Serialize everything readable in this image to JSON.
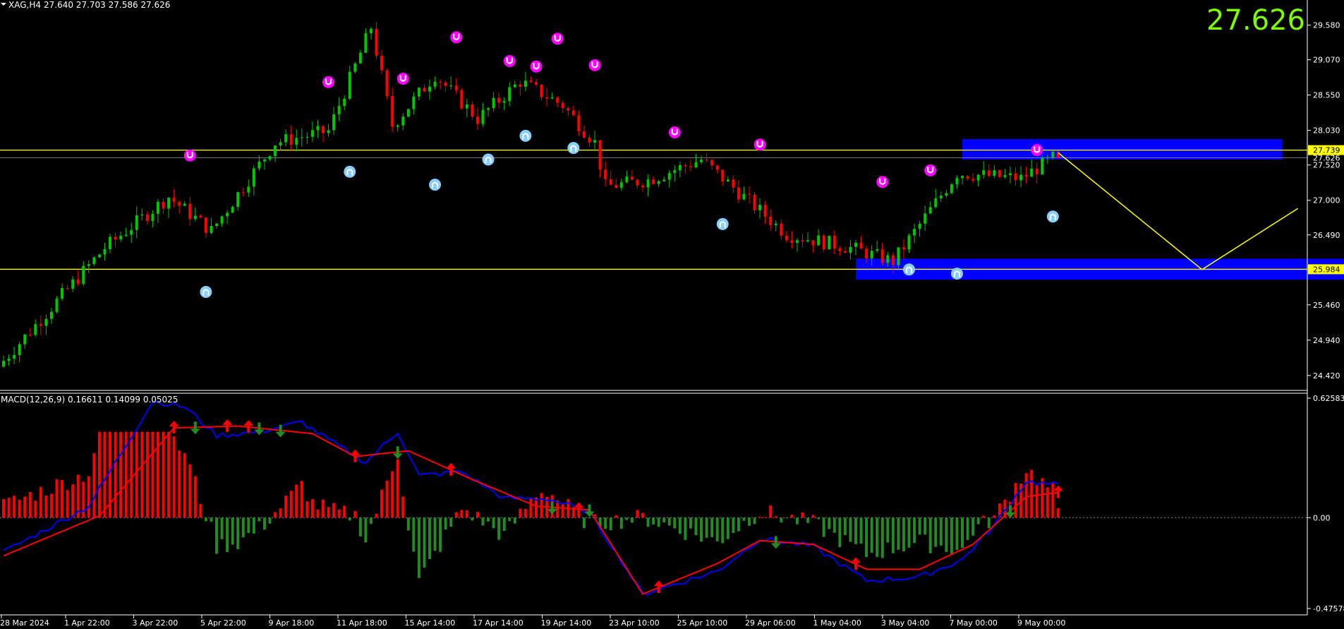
{
  "header": {
    "symbol": "XAG,H4",
    "ohlc": "27.640 27.703 27.586 27.626",
    "big_price": "27.626"
  },
  "macd": {
    "label": "MACD(12,26,9) 0.16611 0.14099 0.05025"
  },
  "colors": {
    "background": "#000000",
    "bull": "#00c800",
    "bear": "#ff0000",
    "level_line": "#ffff00",
    "zone": "#0000ff",
    "fractal_up": "#ff00ff",
    "fractal_down": "#87cefa",
    "macd_line": "#0000ff",
    "signal_line": "#ff0000",
    "big_price": "#7cfc00",
    "axis_text": "#ffffff"
  },
  "chart_data": [
    {
      "type": "candlestick",
      "symbol": "XAG",
      "timeframe": "H4",
      "price_axis": [
        "29.580",
        "29.070",
        "28.550",
        "28.030",
        "27.520",
        "27.000",
        "26.490",
        "25.460",
        "24.940",
        "24.420"
      ],
      "price_labels": [
        {
          "text": "27.739",
          "value": 27.739,
          "style": "yellow"
        },
        {
          "text": "27.626",
          "value": 27.626,
          "style": "plain"
        },
        {
          "text": "25.984",
          "value": 25.984,
          "style": "yellow"
        }
      ],
      "ylim": [
        24.2,
        29.95
      ],
      "time_axis": [
        "28 Mar 2024",
        "1 Apr 22:00",
        "3 Apr 22:00",
        "5 Apr 22:00",
        "9 Apr 18:00",
        "11 Apr 18:00",
        "15 Apr 14:00",
        "17 Apr 14:00",
        "19 Apr 14:00",
        "23 Apr 10:00",
        "25 Apr 10:00",
        "29 Apr 06:00",
        "1 May 04:00",
        "3 May 04:00",
        "7 May 00:00",
        "9 May 00:00"
      ],
      "candle_count": 241,
      "key_points": [
        {
          "bar": 0,
          "price": 24.55
        },
        {
          "bar": 20,
          "price": 26.3
        },
        {
          "bar": 32,
          "price": 27.05
        },
        {
          "bar": 40,
          "price": 26.55
        },
        {
          "bar": 52,
          "price": 27.85
        },
        {
          "bar": 62,
          "price": 28.02
        },
        {
          "bar": 70,
          "price": 29.55
        },
        {
          "bar": 74,
          "price": 28.1
        },
        {
          "bar": 82,
          "price": 28.85
        },
        {
          "bar": 90,
          "price": 28.2
        },
        {
          "bar": 98,
          "price": 28.75
        },
        {
          "bar": 106,
          "price": 28.4
        },
        {
          "bar": 112,
          "price": 27.85
        },
        {
          "bar": 114,
          "price": 27.2
        },
        {
          "bar": 122,
          "price": 27.3
        },
        {
          "bar": 132,
          "price": 27.6
        },
        {
          "bar": 148,
          "price": 26.5
        },
        {
          "bar": 160,
          "price": 26.3
        },
        {
          "bar": 168,
          "price": 26.1
        },
        {
          "bar": 180,
          "price": 27.4
        },
        {
          "bar": 192,
          "price": 27.32
        },
        {
          "bar": 198,
          "price": 27.62
        }
      ],
      "levels": [
        27.739,
        25.984
      ],
      "zones": [
        {
          "from_bar": 180,
          "to_bar": 240,
          "low": 27.6,
          "high": 27.9
        },
        {
          "from_bar": 160,
          "to_bar": 253,
          "low": 25.83,
          "high": 26.14
        }
      ],
      "projection": [
        {
          "bar": 198,
          "price": 27.7
        },
        {
          "bar": 225,
          "price": 25.98
        },
        {
          "bar": 243,
          "price": 26.88
        }
      ],
      "fractals_up": [
        {
          "bar": 35,
          "price": 27.66
        },
        {
          "bar": 61,
          "price": 28.74
        },
        {
          "bar": 75,
          "price": 28.79
        },
        {
          "bar": 85,
          "price": 29.4
        },
        {
          "bar": 95,
          "price": 29.05
        },
        {
          "bar": 100,
          "price": 28.97
        },
        {
          "bar": 104,
          "price": 29.38
        },
        {
          "bar": 111,
          "price": 28.99
        },
        {
          "bar": 126,
          "price": 28.0
        },
        {
          "bar": 142,
          "price": 27.82
        },
        {
          "bar": 165,
          "price": 27.27
        },
        {
          "bar": 174,
          "price": 27.44
        },
        {
          "bar": 194,
          "price": 27.74
        }
      ],
      "fractals_down": [
        {
          "bar": 38,
          "price": 25.65
        },
        {
          "bar": 65,
          "price": 27.42
        },
        {
          "bar": 81,
          "price": 27.23
        },
        {
          "bar": 91,
          "price": 27.6
        },
        {
          "bar": 98,
          "price": 27.95
        },
        {
          "bar": 107,
          "price": 27.77
        },
        {
          "bar": 135,
          "price": 26.65
        },
        {
          "bar": 170,
          "price": 25.98
        },
        {
          "bar": 179,
          "price": 25.92
        },
        {
          "bar": 197,
          "price": 26.76
        }
      ]
    },
    {
      "type": "macd",
      "params": "12,26,9",
      "values": {
        "macd": 0.16611,
        "signal": 0.14099,
        "histogram": 0.05025
      },
      "axis": [
        "0.62583",
        "0.00",
        "-0.47578"
      ],
      "ylim": [
        -0.47578,
        0.62583
      ],
      "macd_key_points": [
        {
          "bar": 0,
          "v": -0.18
        },
        {
          "bar": 16,
          "v": 0.06
        },
        {
          "bar": 28,
          "v": 0.61
        },
        {
          "bar": 34,
          "v": 0.58
        },
        {
          "bar": 40,
          "v": 0.43
        },
        {
          "bar": 48,
          "v": 0.45
        },
        {
          "bar": 56,
          "v": 0.5
        },
        {
          "bar": 62,
          "v": 0.39
        },
        {
          "bar": 68,
          "v": 0.29
        },
        {
          "bar": 74,
          "v": 0.45
        },
        {
          "bar": 78,
          "v": 0.22
        },
        {
          "bar": 86,
          "v": 0.24
        },
        {
          "bar": 94,
          "v": 0.1
        },
        {
          "bar": 102,
          "v": 0.1
        },
        {
          "bar": 110,
          "v": 0.03
        },
        {
          "bar": 120,
          "v": -0.4
        },
        {
          "bar": 134,
          "v": -0.28
        },
        {
          "bar": 142,
          "v": -0.11
        },
        {
          "bar": 152,
          "v": -0.15
        },
        {
          "bar": 162,
          "v": -0.33
        },
        {
          "bar": 172,
          "v": -0.31
        },
        {
          "bar": 180,
          "v": -0.22
        },
        {
          "bar": 186,
          "v": -0.04
        },
        {
          "bar": 192,
          "v": 0.19
        },
        {
          "bar": 200,
          "v": 0.16
        }
      ],
      "signal_key_points": [
        {
          "bar": 0,
          "v": -0.2
        },
        {
          "bar": 18,
          "v": 0.01
        },
        {
          "bar": 32,
          "v": 0.47
        },
        {
          "bar": 44,
          "v": 0.48
        },
        {
          "bar": 58,
          "v": 0.44
        },
        {
          "bar": 66,
          "v": 0.32
        },
        {
          "bar": 76,
          "v": 0.35
        },
        {
          "bar": 88,
          "v": 0.2
        },
        {
          "bar": 100,
          "v": 0.06
        },
        {
          "bar": 110,
          "v": 0.04
        },
        {
          "bar": 120,
          "v": -0.4
        },
        {
          "bar": 134,
          "v": -0.24
        },
        {
          "bar": 142,
          "v": -0.12
        },
        {
          "bar": 152,
          "v": -0.14
        },
        {
          "bar": 162,
          "v": -0.27
        },
        {
          "bar": 172,
          "v": -0.27
        },
        {
          "bar": 182,
          "v": -0.14
        },
        {
          "bar": 192,
          "v": 0.11
        },
        {
          "bar": 200,
          "v": 0.14
        }
      ],
      "arrows_up": [
        32,
        42,
        46,
        66,
        84,
        108,
        123,
        160,
        198
      ],
      "arrows_down": [
        36,
        48,
        52,
        74,
        103,
        110,
        145,
        189
      ]
    }
  ]
}
